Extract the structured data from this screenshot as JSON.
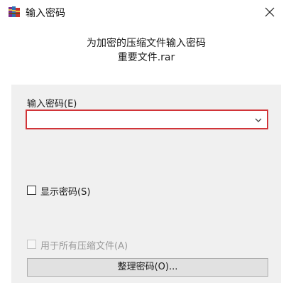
{
  "window": {
    "title": "输入密码",
    "app_icon": "winrar-books-icon",
    "close_icon": "close-icon"
  },
  "header": {
    "line1": "为加密的压缩文件输入密码",
    "line2": "重要文件.rar"
  },
  "password": {
    "label": "输入密码(E)",
    "value": "",
    "dropdown_icon": "chevron-down-icon",
    "border_color": "#d13438"
  },
  "show_password": {
    "label": "显示密码(S)",
    "checked": false
  },
  "use_for_all": {
    "label": "用于所有压缩文件(A)",
    "checked": false,
    "enabled": false
  },
  "organize_button": {
    "label": "整理密码(O)..."
  }
}
